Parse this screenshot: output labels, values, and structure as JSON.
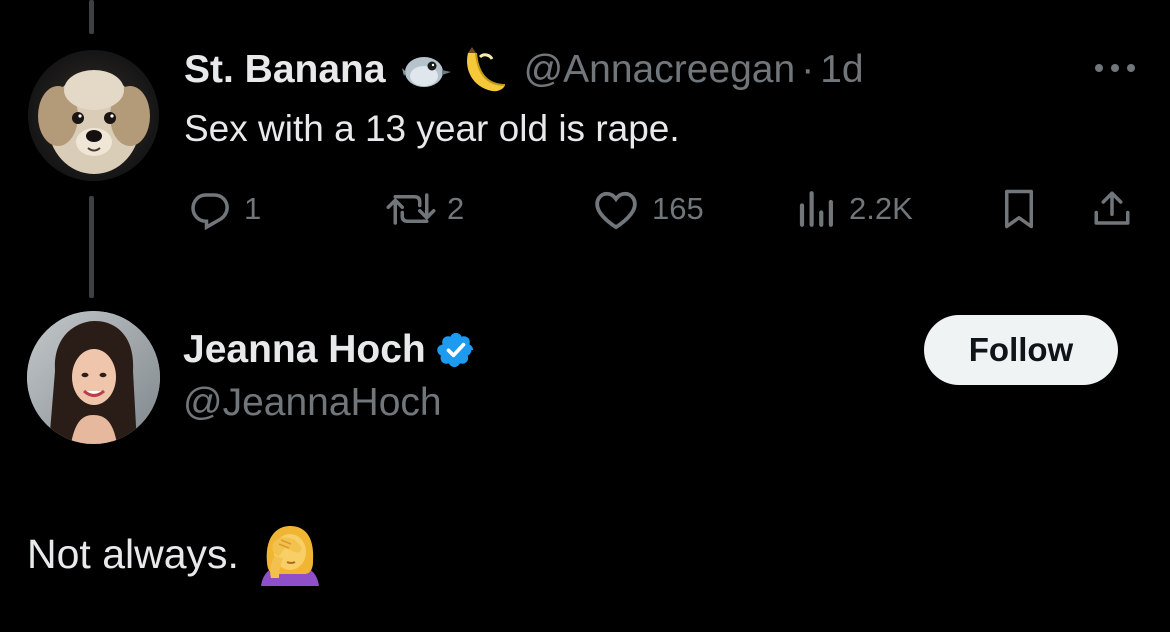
{
  "parent_tweet": {
    "display_name": "St. Banana",
    "name_emojis": "🐦🍌",
    "handle": "@Annacreegan",
    "separator": "·",
    "time": "1d",
    "text": "Sex with a 13 year old is rape.",
    "stats": {
      "replies": "1",
      "reposts": "2",
      "likes": "165",
      "views": "2.2K"
    },
    "more_icon": "more-icon"
  },
  "reply_tweet": {
    "display_name": "Jeanna Hoch",
    "verified": true,
    "handle": "@JeannaHoch",
    "follow_label": "Follow",
    "text": "Not always.",
    "text_emoji": "🤦‍♀️"
  },
  "colors": {
    "background": "#000000",
    "primary_text": "#e7e9ea",
    "secondary_text": "#71767b",
    "verified_blue": "#1d9bf0",
    "follow_bg": "#eff3f4",
    "thread_line": "#3e4144"
  }
}
